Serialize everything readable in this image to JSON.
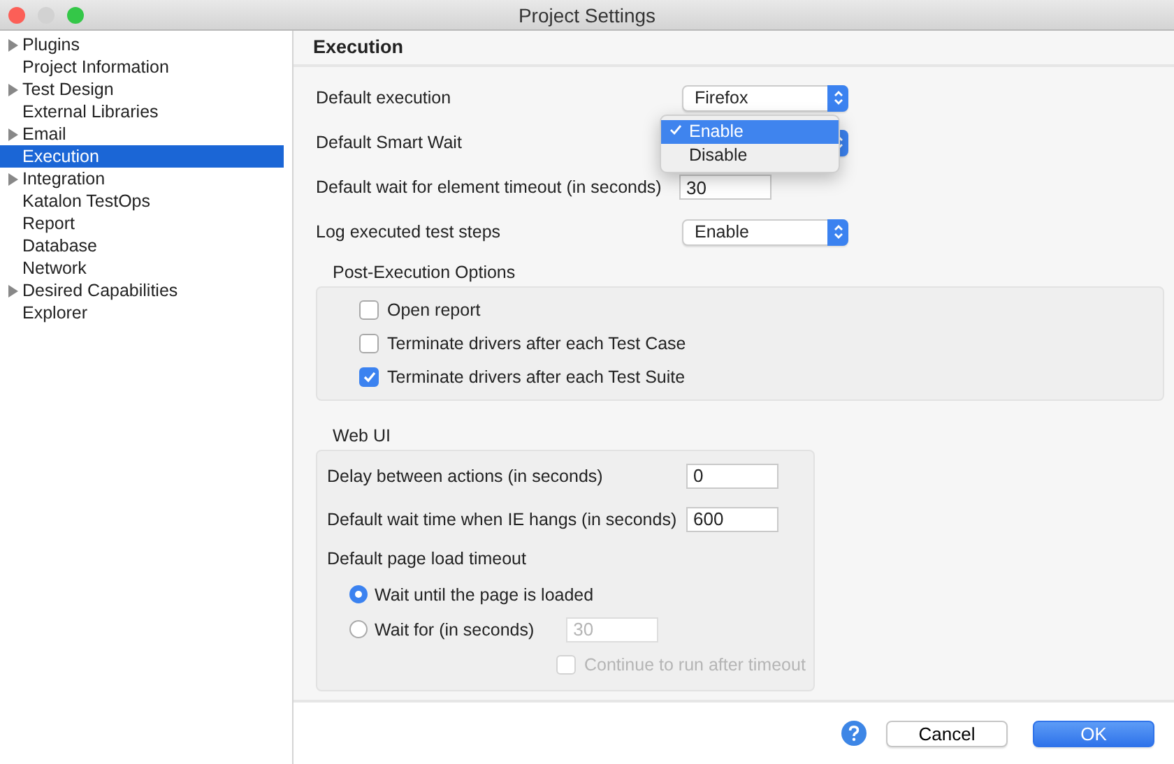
{
  "window": {
    "title": "Project Settings"
  },
  "sidebar": {
    "items": [
      {
        "label": "Plugins",
        "expanded": false,
        "selected": false
      },
      {
        "label": "Project Information",
        "selected": false
      },
      {
        "label": "Test Design",
        "expanded": false,
        "selected": false
      },
      {
        "label": "External Libraries",
        "selected": false
      },
      {
        "label": "Email",
        "expanded": false,
        "selected": false
      },
      {
        "label": "Execution",
        "selected": true
      },
      {
        "label": "Integration",
        "expanded": false,
        "selected": false
      },
      {
        "label": "Katalon TestOps",
        "selected": false
      },
      {
        "label": "Report",
        "selected": false
      },
      {
        "label": "Database",
        "selected": false
      },
      {
        "label": "Network",
        "selected": false
      },
      {
        "label": "Desired Capabilities",
        "expanded": false,
        "selected": false
      },
      {
        "label": "Explorer",
        "selected": false
      }
    ]
  },
  "panel": {
    "title": "Execution",
    "settings": [
      {
        "kind": "select",
        "label": "Default execution",
        "value": "Firefox"
      },
      {
        "kind": "menu",
        "label": "Default Smart Wait",
        "options": [
          {
            "label": "Enable",
            "selected": true
          },
          {
            "label": "Disable",
            "selected": false
          }
        ]
      },
      {
        "kind": "input",
        "label": "Default wait for element timeout (in seconds)",
        "value": "30"
      },
      {
        "kind": "select",
        "label": "Log executed test steps",
        "value": "Enable"
      }
    ],
    "post_execution": {
      "title": "Post-Execution Options",
      "options": [
        {
          "label": "Open report",
          "checked": false
        },
        {
          "label": "Terminate drivers after each Test Case",
          "checked": false
        },
        {
          "label": "Terminate drivers after each Test Suite",
          "checked": true
        }
      ]
    },
    "web_ui": {
      "title": "Web UI",
      "fields": [
        {
          "label": "Delay between actions (in seconds)",
          "value": "0"
        },
        {
          "label": "Default wait time when IE hangs (in seconds)",
          "value": "600"
        }
      ],
      "page_load": {
        "label": "Default page load timeout",
        "choices": [
          {
            "label": "Wait until the page is loaded",
            "selected": true
          },
          {
            "label": "Wait for (in seconds)",
            "selected": false,
            "placeholder": "30",
            "disabled": true
          }
        ],
        "continue": {
          "label": "Continue to run after timeout",
          "checked": false,
          "disabled": true
        }
      }
    }
  },
  "buttons": [
    {
      "label": "Cancel",
      "default": false
    },
    {
      "label": "OK",
      "default": true
    }
  ]
}
